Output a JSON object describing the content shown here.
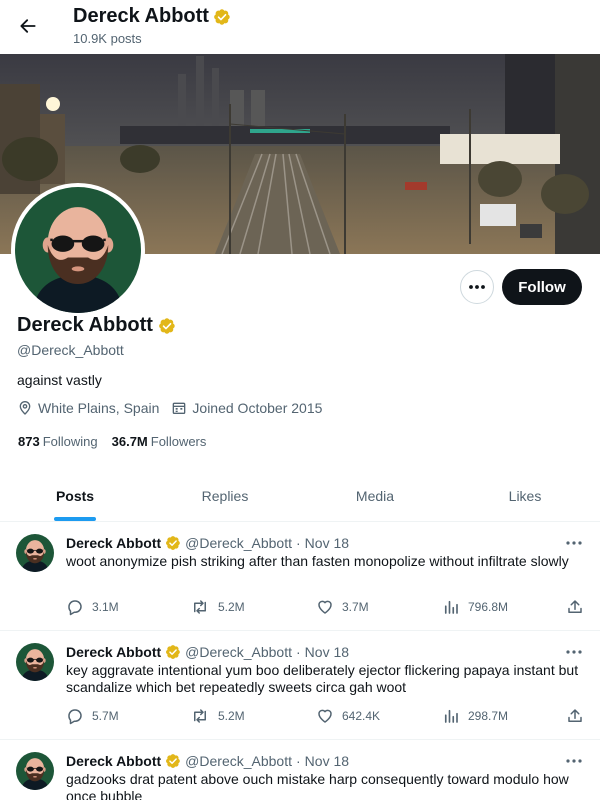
{
  "header": {
    "name": "Dereck Abbott",
    "posts_count": "10.9K posts"
  },
  "profile": {
    "name": "Dereck Abbott",
    "handle": "@Dereck_Abbott",
    "bio": "against vastly",
    "location": "White Plains, Spain",
    "joined": "Joined October 2015",
    "following_count": "873",
    "following_label": "Following",
    "followers_count": "36.7M",
    "followers_label": "Followers",
    "follow_label": "Follow"
  },
  "tabs": [
    {
      "label": "Posts"
    },
    {
      "label": "Replies"
    },
    {
      "label": "Media"
    },
    {
      "label": "Likes"
    }
  ],
  "tweets": [
    {
      "name": "Dereck Abbott",
      "handle": "@Dereck_Abbott",
      "dot": "·",
      "date": "Nov 18",
      "text": "woot anonymize pish striking after than fasten monopolize without infiltrate slowly",
      "replies": "3.1M",
      "retweets": "5.2M",
      "likes": "3.7M",
      "views": "796.8M"
    },
    {
      "name": "Dereck Abbott",
      "handle": "@Dereck_Abbott",
      "dot": "·",
      "date": "Nov 18",
      "text": "key aggravate intentional yum boo deliberately ejector flickering papaya instant but scandalize which bet repeatedly sweets circa gah woot",
      "replies": "5.7M",
      "retweets": "5.2M",
      "likes": "642.4K",
      "views": "298.7M"
    },
    {
      "name": "Dereck Abbott",
      "handle": "@Dereck_Abbott",
      "dot": "·",
      "date": "Nov 18",
      "text": "gadzooks drat patent above ouch mistake harp consequently toward modulo how once bubble",
      "replies": "",
      "retweets": "",
      "likes": "",
      "views": ""
    }
  ],
  "colors": {
    "accent": "#1d9bf0",
    "verified": "#e2b719",
    "text": "#0f1419",
    "muted": "#536471"
  },
  "icons": [
    "back-arrow-icon",
    "verified-badge-icon",
    "more-icon",
    "location-icon",
    "calendar-icon",
    "reply-icon",
    "retweet-icon",
    "like-icon",
    "views-icon",
    "share-icon"
  ]
}
